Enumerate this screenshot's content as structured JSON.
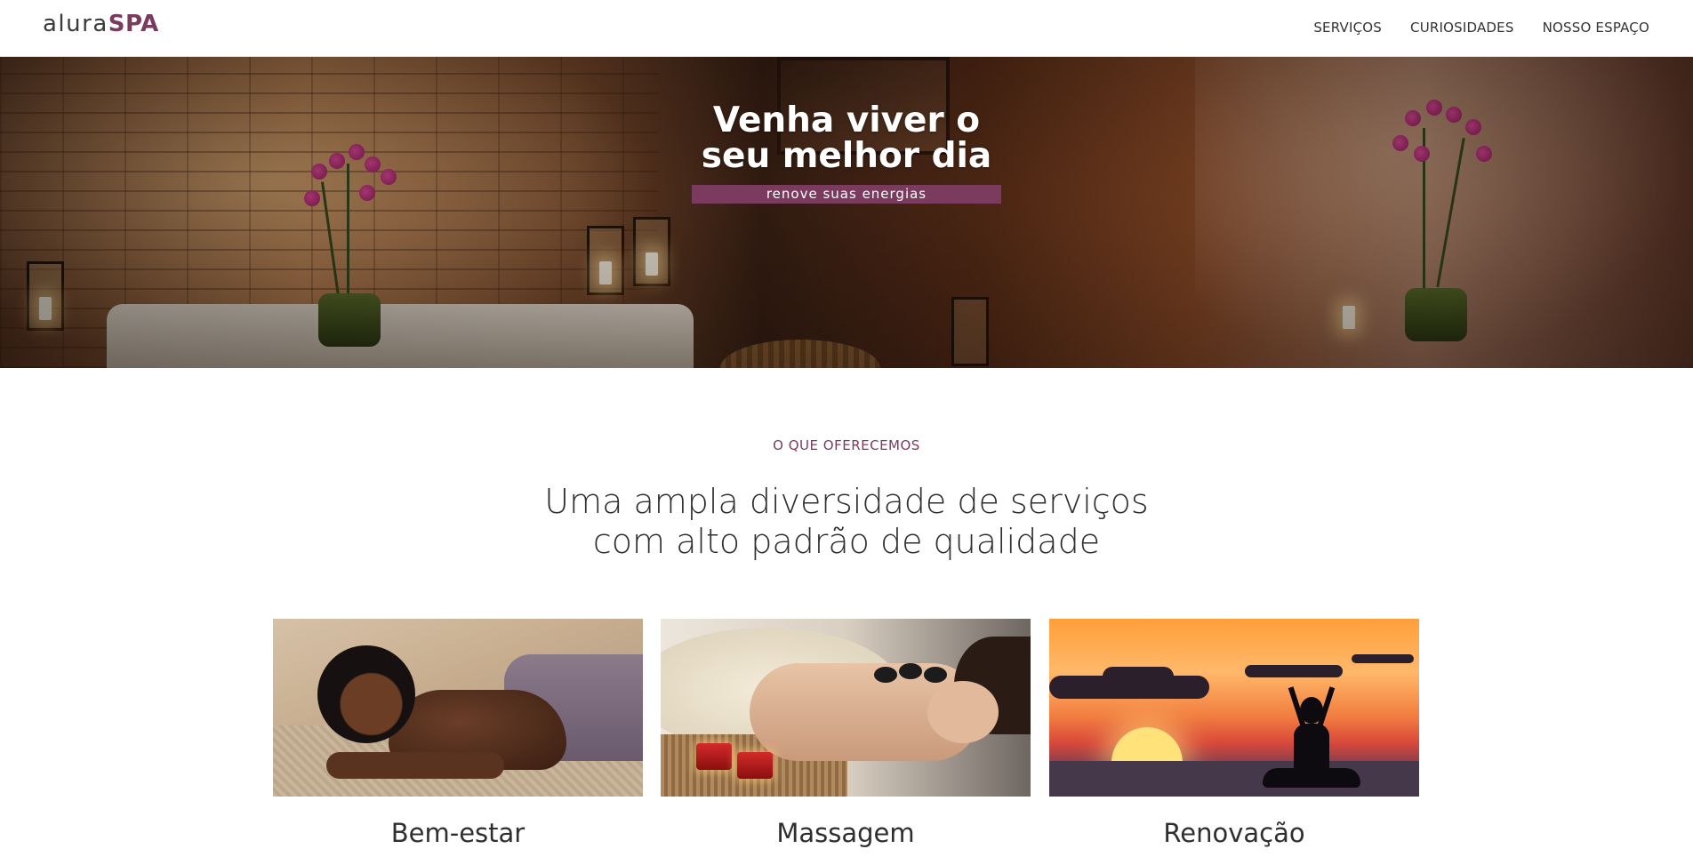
{
  "brand": {
    "name_light": "alura",
    "name_strong": "SPA",
    "accent": "#7a3b5e"
  },
  "nav": {
    "items": [
      {
        "label": "SERVIÇOS"
      },
      {
        "label": "CURIOSIDADES"
      },
      {
        "label": "NOSSO ESPAÇO"
      }
    ]
  },
  "hero": {
    "title_line1": "Venha viver o",
    "title_line2": "seu melhor dia",
    "subtitle": "renove suas energias"
  },
  "services": {
    "eyebrow": "O QUE OFERECEMOS",
    "title_line1": "Uma ampla diversidade de serviços",
    "title_line2": "com alto padrão de qualidade",
    "cards": [
      {
        "label": "Bem-estar"
      },
      {
        "label": "Massagem"
      },
      {
        "label": "Renovação"
      }
    ]
  }
}
